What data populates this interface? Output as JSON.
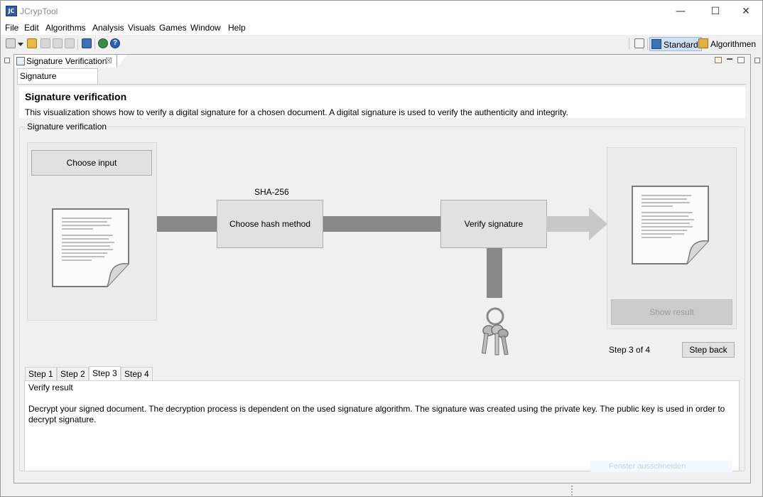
{
  "window": {
    "app_icon_text": "JC",
    "title": "JCrypTool",
    "controls": [
      "—",
      "☐",
      "✕"
    ]
  },
  "menu": [
    "File",
    "Edit",
    "Algorithms",
    "Analysis",
    "Visuals",
    "Games",
    "Window",
    "Help"
  ],
  "perspectives": {
    "standard": "Standard",
    "algorithms": "Algorithmen"
  },
  "editor": {
    "tab_label": "Signature Verification",
    "tab_close": "☒",
    "inner_tab": "Signature verification"
  },
  "header": {
    "title": "Signature verification",
    "description": "This visualization shows how to verify a digital signature for a chosen document. A digital signature is used to verify the authenticity and integrity."
  },
  "group": {
    "label": "Signature verification",
    "choose_input": "Choose input",
    "hash_label": "SHA-256",
    "choose_hash": "Choose hash method",
    "verify_signature": "Verify signature",
    "show_result": "Show result",
    "step_counter": "Step 3 of 4",
    "step_back": "Step back"
  },
  "steps": {
    "tabs": [
      "Step 1",
      "Step 2",
      "Step 3",
      "Step 4"
    ],
    "active": 3,
    "heading": "Verify result",
    "text": "Decrypt your signed document. The decryption process is dependent on the used signature algorithm. The signature was created using the private key. The public key is used in order to decrypt signature."
  },
  "ghost_text": "Fenster ausschneiden",
  "colors": {
    "arrow": "#888888",
    "arrow_light": "#c8c8c8",
    "perspective_active": "#cfe0f3"
  }
}
